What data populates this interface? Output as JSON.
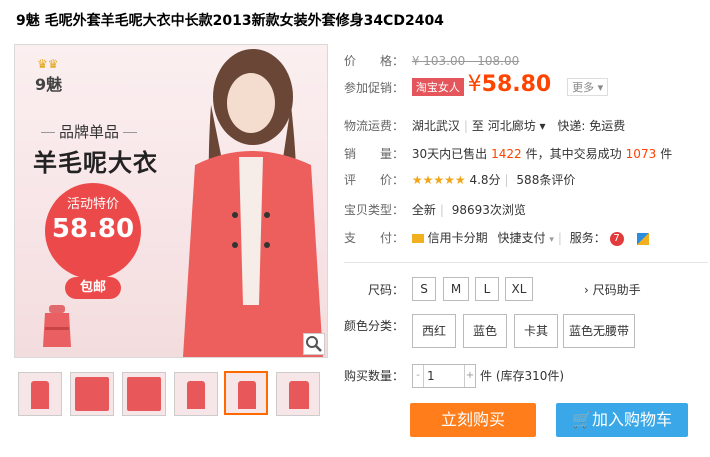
{
  "title": "9魅 毛呢外套羊毛呢大衣中长款2013新款女装外套修身34CD2404",
  "image": {
    "logo_brand": "9魅",
    "tag_line1": "品牌单品",
    "tag_line2": "羊毛呢大衣",
    "circle_label": "活动特价",
    "circle_price": "58.80",
    "badge": "包邮"
  },
  "info": {
    "price_label": "价　　格：",
    "original_price": "¥ 103.00 - 108.00",
    "promo_label": "参加促销：",
    "promo_tag": "淘宝女人",
    "promo_yen": "¥",
    "promo_price": "58.80",
    "more": "更多 ▾",
    "shipping_label": "物流运费：",
    "ship_from": "湖北武汉",
    "ship_to_prefix": "至",
    "ship_to": "河北廊坊 ▾",
    "express": "快递: 免运费",
    "sales_label": "销　　量：",
    "sales_text_1": "30天内已售出",
    "sales_count": "1422",
    "sales_text_2": "件，其中交易成功",
    "success_count": "1073",
    "sales_text_3": "件",
    "rating_label": "评　　价：",
    "rating_stars": "★★★★★",
    "rating_score": "4.8分",
    "reviews": "588条评价",
    "type_label": "宝贝类型：",
    "type_value": "全新",
    "views": "98693次浏览",
    "pay_label": "支　　付：",
    "pay_credit": "信用卡分期",
    "pay_quick": "快捷支付",
    "service_label": "服务："
  },
  "options": {
    "size_label": "尺码：",
    "sizes": [
      "S",
      "M",
      "L",
      "XL"
    ],
    "size_helper": "› 尺码助手",
    "color_label": "颜色分类：",
    "colors": [
      "西红",
      "蓝色",
      "卡其",
      "蓝色无腰带"
    ],
    "qty_label": "购买数量：",
    "qty_minus": "-",
    "qty_value": "1",
    "qty_plus": "+",
    "stock": "件 (库存310件)"
  },
  "buttons": {
    "buy": "立刻购买",
    "cart": "加入购物车"
  },
  "colors": {
    "accent": "#ff4400",
    "buy_button": "#ff7d1a",
    "cart_button": "#3aa8e8",
    "promo_tag": "#e5565c"
  }
}
